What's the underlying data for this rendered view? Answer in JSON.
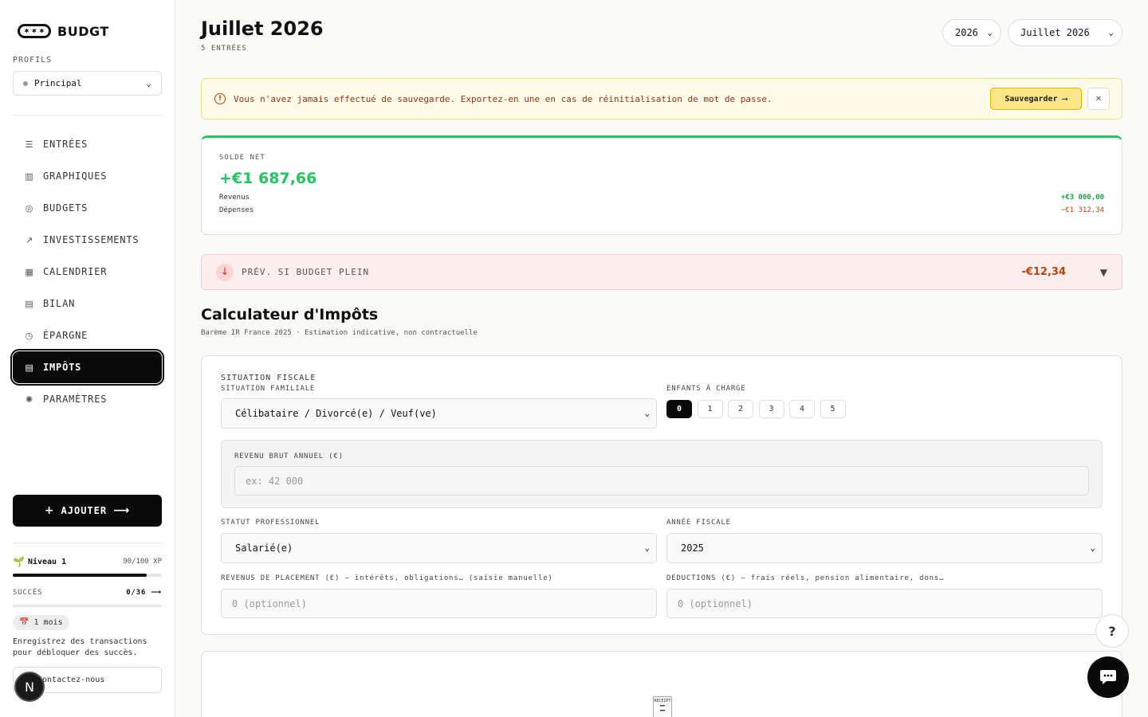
{
  "sidebar": {
    "brand": "BUDGT",
    "profiles_label": "PROFILS",
    "profile_selected": "Principal",
    "nav": [
      {
        "label": "ENTRÉES",
        "icon": "list-icon"
      },
      {
        "label": "GRAPHIQUES",
        "icon": "bar-chart-icon"
      },
      {
        "label": "BUDGETS",
        "icon": "coin-icon"
      },
      {
        "label": "INVESTISSEMENTS",
        "icon": "trend-up-icon"
      },
      {
        "label": "CALENDRIER",
        "icon": "calendar-icon"
      },
      {
        "label": "BILAN",
        "icon": "document-icon"
      },
      {
        "label": "ÉPARGNE",
        "icon": "clock-icon"
      },
      {
        "label": "IMPÔTS",
        "icon": "receipt-icon",
        "active": true
      },
      {
        "label": "PARAMÈTRES",
        "icon": "gear-icon"
      }
    ],
    "add_label": "AJOUTER",
    "level_label": "Niveau 1",
    "xp_label": "90/100 XP",
    "xp_fraction": 0.9,
    "success_label": "SUCCÈS",
    "success_value": "0/36",
    "streak_label": "1 mois",
    "hint": "Enregistrez des transactions pour débloquer des succès.",
    "contact_label": "Contactez-nous",
    "badge_letter": "N"
  },
  "header": {
    "title": "Juillet 2026",
    "entries_count": "5 ENTRÉES",
    "year_select": "2026",
    "month_select": "Juillet 2026"
  },
  "alert": {
    "message": "Vous n'avez jamais effectué de sauvegarde. Exportez-en une en cas de réinitialisation de mot de passe.",
    "save_label": "Sauvegarder ⟶",
    "close_label": "✕"
  },
  "balance": {
    "label": "SOLDE NET",
    "net": "+€1 687,66",
    "income_label": "Revenus",
    "income_value": "+€3 000,00",
    "expense_label": "Dépenses",
    "expense_value": "−€1 312,34"
  },
  "forecast": {
    "label": "PRÉV. SI BUDGET PLEIN",
    "value": "-€12,34"
  },
  "calculator": {
    "title": "Calculateur d'Impôts",
    "subtitle": "Barème IR France 2025 · Estimation indicative, non contractuelle",
    "section_title": "SITUATION FISCALE",
    "family_label": "SITUATION FAMILIALE",
    "family_value": "Célibataire / Divorcé(e) / Veuf(ve)",
    "children_label": "ENFANTS À CHARGE",
    "children_options": [
      "0",
      "1",
      "2",
      "3",
      "4",
      "5"
    ],
    "children_selected": "0",
    "income_label": "REVENU BRUT ANNUEL (€)",
    "income_placeholder": "ex: 42 000",
    "status_label": "STATUT PROFESSIONNEL",
    "status_value": "Salarié(e)",
    "year_label": "ANNÉE FISCALE",
    "year_value": "2025",
    "invest_label": "REVENUS DE PLACEMENT (€) — intérêts, obligations… (saisie manuelle)",
    "invest_placeholder": "0 (optionnel)",
    "deduct_label": "DÉDUCTIONS (€) — frais réels, pension alimentaire, dons…",
    "deduct_placeholder": "0 (optionnel)"
  },
  "receipt_text": "RECEIPT",
  "help_label": "?"
}
